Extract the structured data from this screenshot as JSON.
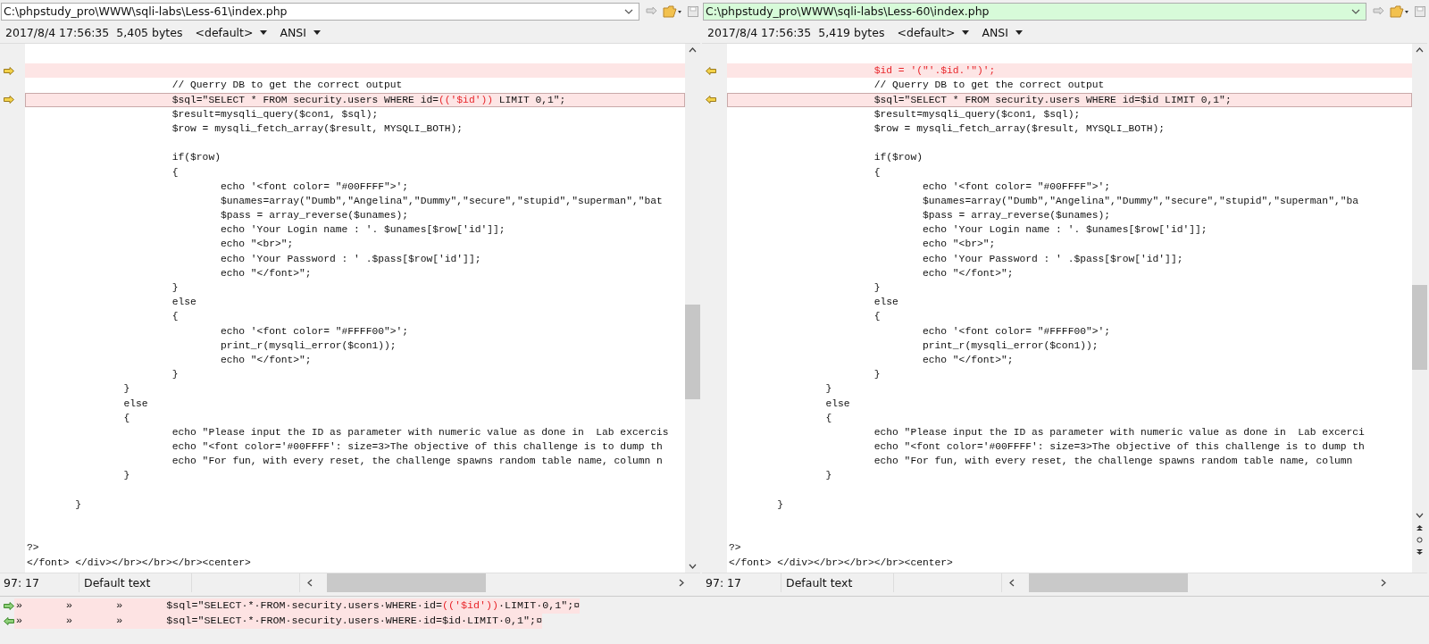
{
  "panes": [
    {
      "points_left": false,
      "active": false,
      "path": "C:\\phpstudy_pro\\WWW\\sqli-labs\\Less-61\\index.php",
      "info": {
        "date": "2017/8/4 17:56:35",
        "size": "5,405 bytes",
        "codepage": "<default>",
        "encoding": "ANSI"
      },
      "lines": [
        {
          "kind": "same"
        },
        {
          "kind": "missing",
          "current": false
        },
        {
          "kind": "same",
          "text": "\t\t\t// Querry DB to get the correct output"
        },
        {
          "kind": "diff",
          "current": true,
          "parts": [
            {
              "text": "\t\t\t$sql=\"SELECT * FROM security.users WHERE id=",
              "changed": false
            },
            {
              "text": "(('$id'))",
              "changed": true
            },
            {
              "text": " LIMIT 0,1\";",
              "changed": false
            }
          ]
        },
        {
          "kind": "same",
          "text": "\t\t\t$result=mysqli_query($con1, $sql);"
        },
        {
          "kind": "same",
          "text": "\t\t\t$row = mysqli_fetch_array($result, MYSQLI_BOTH);"
        },
        {
          "kind": "same"
        },
        {
          "kind": "same",
          "text": "\t\t\tif($row)"
        },
        {
          "kind": "same",
          "text": "\t\t\t{"
        },
        {
          "kind": "same",
          "text": "\t\t\t\techo '<font color= \"#00FFFF\">';"
        },
        {
          "kind": "same",
          "text": "\t\t\t\t$unames=array(\"Dumb\",\"Angelina\",\"Dummy\",\"secure\",\"stupid\",\"superman\",\"bat"
        },
        {
          "kind": "same",
          "text": "\t\t\t\t$pass = array_reverse($unames);"
        },
        {
          "kind": "same",
          "text": "\t\t\t\techo 'Your Login name : '. $unames[$row['id']];"
        },
        {
          "kind": "same",
          "text": "\t\t\t\techo \"<br>\";"
        },
        {
          "kind": "same",
          "text": "\t\t\t\techo 'Your Password : ' .$pass[$row['id']];"
        },
        {
          "kind": "same",
          "text": "\t\t\t\techo \"</font>\";"
        },
        {
          "kind": "same",
          "text": "\t\t\t}"
        },
        {
          "kind": "same",
          "text": "\t\t\telse"
        },
        {
          "kind": "same",
          "text": "\t\t\t{"
        },
        {
          "kind": "same",
          "text": "\t\t\t\techo '<font color= \"#FFFF00\">';"
        },
        {
          "kind": "same",
          "text": "\t\t\t\tprint_r(mysqli_error($con1));"
        },
        {
          "kind": "same",
          "text": "\t\t\t\techo \"</font>\";"
        },
        {
          "kind": "same",
          "text": "\t\t\t}"
        },
        {
          "kind": "same",
          "text": "\t\t}"
        },
        {
          "kind": "same",
          "text": "\t\telse"
        },
        {
          "kind": "same",
          "text": "\t\t{"
        },
        {
          "kind": "same",
          "text": "\t\t\techo \"Please input the ID as parameter with numeric value as done in  Lab excercis"
        },
        {
          "kind": "same",
          "text": "\t\t\techo \"<font color='#00FFFF': size=3>The objective of this challenge is to dump th"
        },
        {
          "kind": "same",
          "text": "\t\t\techo \"For fun, with every reset, the challenge spawns random table name, column n"
        },
        {
          "kind": "same",
          "text": "\t\t}"
        },
        {
          "kind": "same"
        },
        {
          "kind": "same",
          "text": "\t}"
        },
        {
          "kind": "same"
        },
        {
          "kind": "same"
        },
        {
          "kind": "same",
          "text": "?>"
        },
        {
          "kind": "same",
          "text": "</font> </div></br></br></br><center>"
        }
      ],
      "status": {
        "position": "97: 17",
        "syntax": "Default text"
      }
    },
    {
      "points_left": true,
      "active": true,
      "path": "C:\\phpstudy_pro\\WWW\\sqli-labs\\Less-60\\index.php",
      "info": {
        "date": "2017/8/4 17:56:35",
        "size": "5,419 bytes",
        "codepage": "<default>",
        "encoding": "ANSI"
      },
      "lines": [
        {
          "kind": "same"
        },
        {
          "kind": "diff",
          "current": false,
          "parts": [
            {
              "text": "\t\t\t$id = '(\"'.$id.'\")';",
              "changed": true
            }
          ]
        },
        {
          "kind": "same",
          "text": "\t\t\t// Querry DB to get the correct output"
        },
        {
          "kind": "diff",
          "current": true,
          "parts": [
            {
              "text": "\t\t\t$sql=\"SELECT * FROM security.users WHERE id=$id LIMIT 0,1\";",
              "changed": false
            }
          ]
        },
        {
          "kind": "same",
          "text": "\t\t\t$result=mysqli_query($con1, $sql);"
        },
        {
          "kind": "same",
          "text": "\t\t\t$row = mysqli_fetch_array($result, MYSQLI_BOTH);"
        },
        {
          "kind": "same"
        },
        {
          "kind": "same",
          "text": "\t\t\tif($row)"
        },
        {
          "kind": "same",
          "text": "\t\t\t{"
        },
        {
          "kind": "same",
          "text": "\t\t\t\techo '<font color= \"#00FFFF\">';"
        },
        {
          "kind": "same",
          "text": "\t\t\t\t$unames=array(\"Dumb\",\"Angelina\",\"Dummy\",\"secure\",\"stupid\",\"superman\",\"ba"
        },
        {
          "kind": "same",
          "text": "\t\t\t\t$pass = array_reverse($unames);"
        },
        {
          "kind": "same",
          "text": "\t\t\t\techo 'Your Login name : '. $unames[$row['id']];"
        },
        {
          "kind": "same",
          "text": "\t\t\t\techo \"<br>\";"
        },
        {
          "kind": "same",
          "text": "\t\t\t\techo 'Your Password : ' .$pass[$row['id']];"
        },
        {
          "kind": "same",
          "text": "\t\t\t\techo \"</font>\";"
        },
        {
          "kind": "same",
          "text": "\t\t\t}"
        },
        {
          "kind": "same",
          "text": "\t\t\telse"
        },
        {
          "kind": "same",
          "text": "\t\t\t{"
        },
        {
          "kind": "same",
          "text": "\t\t\t\techo '<font color= \"#FFFF00\">';"
        },
        {
          "kind": "same",
          "text": "\t\t\t\tprint_r(mysqli_error($con1));"
        },
        {
          "kind": "same",
          "text": "\t\t\t\techo \"</font>\";"
        },
        {
          "kind": "same",
          "text": "\t\t\t}"
        },
        {
          "kind": "same",
          "text": "\t\t}"
        },
        {
          "kind": "same",
          "text": "\t\telse"
        },
        {
          "kind": "same",
          "text": "\t\t{"
        },
        {
          "kind": "same",
          "text": "\t\t\techo \"Please input the ID as parameter with numeric value as done in  Lab excerci"
        },
        {
          "kind": "same",
          "text": "\t\t\techo \"<font color='#00FFFF': size=3>The objective of this challenge is to dump th"
        },
        {
          "kind": "same",
          "text": "\t\t\techo \"For fun, with every reset, the challenge spawns random table name, column"
        },
        {
          "kind": "same",
          "text": "\t\t}"
        },
        {
          "kind": "same"
        },
        {
          "kind": "same",
          "text": "\t}"
        },
        {
          "kind": "same"
        },
        {
          "kind": "same"
        },
        {
          "kind": "same",
          "text": "?>"
        },
        {
          "kind": "same",
          "text": "</font> </div></br></br></br><center>"
        }
      ],
      "status": {
        "position": "97: 17",
        "syntax": "Default text"
      }
    }
  ],
  "detail_lines": [
    {
      "points_left": false,
      "parts": [
        {
          "text": "»\t»\t»\t$sql=\"SELECT·*·FROM·security.users·WHERE·id=",
          "changed": false
        },
        {
          "text": "(('$id'))",
          "changed": true
        },
        {
          "text": "·LIMIT·0,1\";¤",
          "changed": false
        }
      ]
    },
    {
      "points_left": true,
      "parts": [
        {
          "text": "»\t»\t»\t$sql=\"SELECT·*·FROM·security.users·WHERE·id=$id·LIMIT·0,1\";¤",
          "changed": false
        }
      ]
    }
  ]
}
